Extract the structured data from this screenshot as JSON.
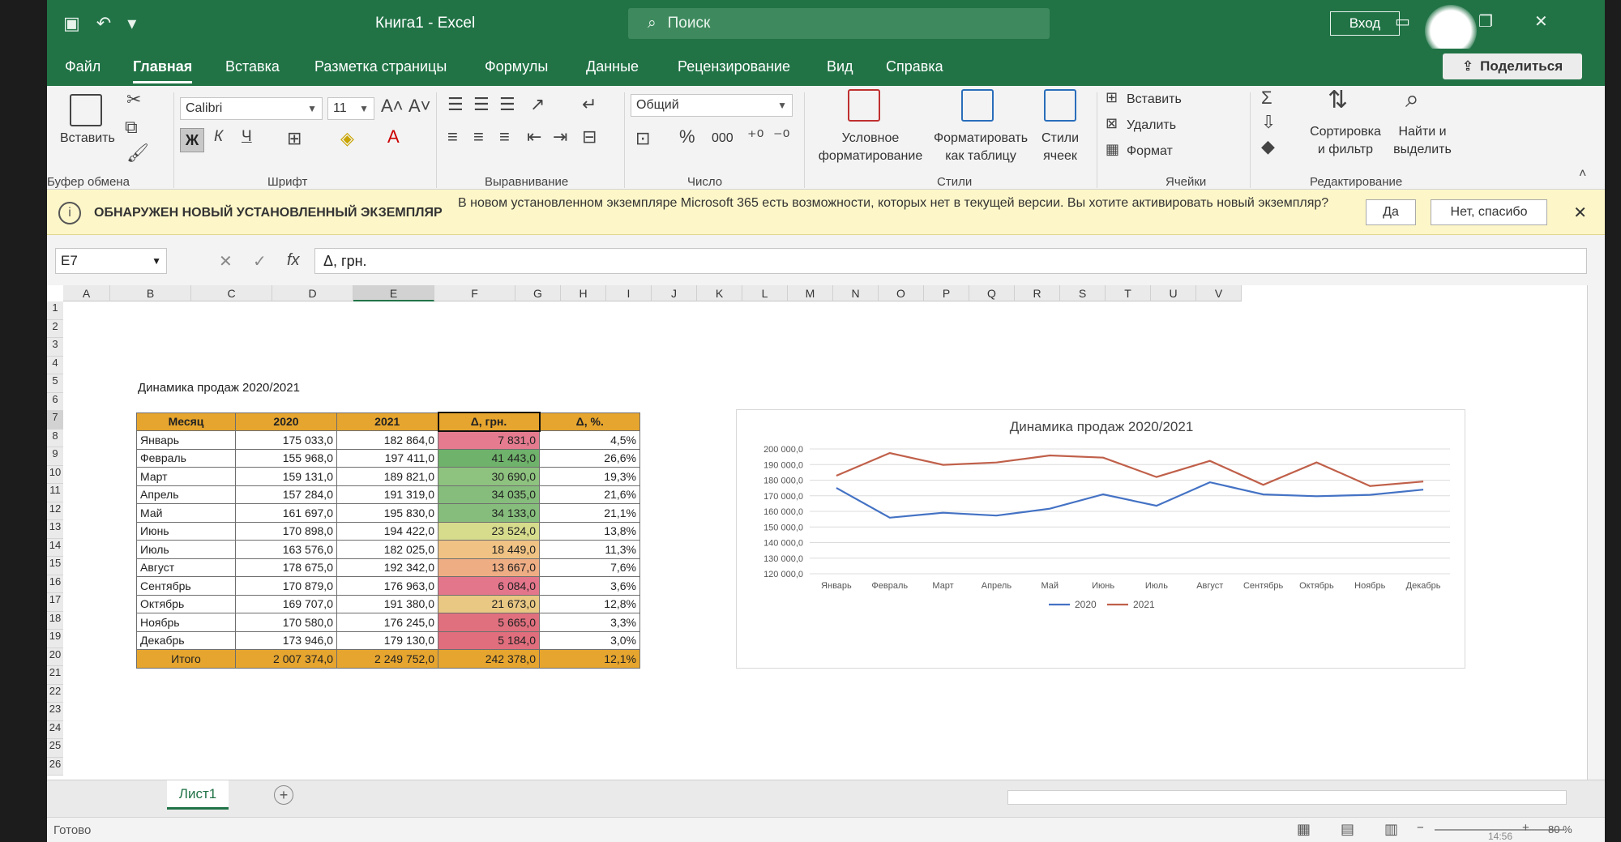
{
  "titlebar": {
    "doc_title": "Книга1 - Excel",
    "search_placeholder": "Поиск",
    "login_label": "Вход"
  },
  "tabs": [
    "Файл",
    "Главная",
    "Вставка",
    "Разметка страницы",
    "Формулы",
    "Данные",
    "Рецензирование",
    "Вид",
    "Справка"
  ],
  "share_label": "Поделиться",
  "ribbon": {
    "clipboard": {
      "paste": "Вставить",
      "label": "Буфер обмена"
    },
    "font": {
      "name": "Calibri",
      "size": "11",
      "bold": "Ж",
      "italic": "К",
      "underline": "Ч",
      "label": "Шрифт"
    },
    "alignment": {
      "label": "Выравнивание"
    },
    "number": {
      "format": "Общий",
      "percent": "%",
      "thousands": "000",
      "label": "Число"
    },
    "styles": {
      "cond_format": "Условное форматирование",
      "format_table": "Форматировать как таблицу",
      "cell_styles": "Стили ячеек",
      "label": "Стили"
    },
    "cells": {
      "insert": "Вставить",
      "delete": "Удалить",
      "format": "Формат",
      "label": "Ячейки"
    },
    "editing": {
      "sort": "Сортировка и фильтр",
      "find": "Найти и выделить",
      "label": "Редактирование"
    }
  },
  "notification": {
    "title": "ОБНАРУЖЕН НОВЫЙ УСТАНОВЛЕННЫЙ ЭКЗЕМПЛЯР",
    "message": "В новом установленном экземпляре Microsoft 365 есть возможности, которых нет в текущей версии. Вы хотите активировать новый экземпляр?",
    "yes": "Да",
    "no": "Нет, спасибо"
  },
  "formula_bar": {
    "name_box": "E7",
    "fx": "fx",
    "content": "Δ, грн."
  },
  "columns": [
    "A",
    "B",
    "C",
    "D",
    "E",
    "F",
    "G",
    "H",
    "I",
    "J",
    "K",
    "L",
    "M",
    "N",
    "O",
    "P",
    "Q",
    "R",
    "S",
    "T",
    "U",
    "V"
  ],
  "rows": [
    "1",
    "2",
    "3",
    "4",
    "5",
    "6",
    "7",
    "8",
    "9",
    "10",
    "11",
    "12",
    "13",
    "14",
    "15",
    "16",
    "17",
    "18",
    "19",
    "20",
    "21",
    "22",
    "23",
    "24",
    "25",
    "26"
  ],
  "table": {
    "title": "Динамика продаж 2020/2021",
    "headers": [
      "Месяц",
      "2020",
      "2021",
      "Δ, грн.",
      "Δ, %."
    ],
    "rows": [
      [
        "Январь",
        "175 033,0",
        "182 864,0",
        "7 831,0",
        "4,5%"
      ],
      [
        "Февраль",
        "155 968,0",
        "197 411,0",
        "41 443,0",
        "26,6%"
      ],
      [
        "Март",
        "159 131,0",
        "189 821,0",
        "30 690,0",
        "19,3%"
      ],
      [
        "Апрель",
        "157 284,0",
        "191 319,0",
        "34 035,0",
        "21,6%"
      ],
      [
        "Май",
        "161 697,0",
        "195 830,0",
        "34 133,0",
        "21,1%"
      ],
      [
        "Июнь",
        "170 898,0",
        "194 422,0",
        "23 524,0",
        "13,8%"
      ],
      [
        "Июль",
        "163 576,0",
        "182 025,0",
        "18 449,0",
        "11,3%"
      ],
      [
        "Август",
        "178 675,0",
        "192 342,0",
        "13 667,0",
        "7,6%"
      ],
      [
        "Сентябрь",
        "170 879,0",
        "176 963,0",
        "6 084,0",
        "3,6%"
      ],
      [
        "Октябрь",
        "169 707,0",
        "191 380,0",
        "21 673,0",
        "12,8%"
      ],
      [
        "Ноябрь",
        "170 580,0",
        "176 245,0",
        "5 665,0",
        "3,3%"
      ],
      [
        "Декабрь",
        "173 946,0",
        "179 130,0",
        "5 184,0",
        "3,0%"
      ]
    ],
    "delta_colors": [
      "#e47b8f",
      "#6fb26b",
      "#8ec27f",
      "#86bd7c",
      "#86bd7c",
      "#d7dc8d",
      "#f0c384",
      "#efad84",
      "#e4768c",
      "#e9c884",
      "#e0707e",
      "#e06e7d"
    ],
    "total": [
      "Итого",
      "2 007 374,0",
      "2 249 752,0",
      "242 378,0",
      "12,1%"
    ]
  },
  "chart_data": {
    "type": "line",
    "title": "Динамика продаж 2020/2021",
    "categories": [
      "Январь",
      "Февраль",
      "Март",
      "Апрель",
      "Май",
      "Июнь",
      "Июль",
      "Август",
      "Сентябрь",
      "Октябрь",
      "Ноябрь",
      "Декабрь"
    ],
    "series": [
      {
        "name": "2020",
        "color": "#4472c4",
        "values": [
          175033,
          155968,
          159131,
          157284,
          161697,
          170898,
          163576,
          178675,
          170879,
          169707,
          170580,
          173946
        ]
      },
      {
        "name": "2021",
        "color": "#c0604a",
        "values": [
          182864,
          197411,
          189821,
          191319,
          195830,
          194422,
          182025,
          192342,
          176963,
          191380,
          176245,
          179130
        ]
      }
    ],
    "ylim": [
      120000,
      200000
    ],
    "yticks": [
      "120 000,0",
      "130 000,0",
      "140 000,0",
      "150 000,0",
      "160 000,0",
      "170 000,0",
      "180 000,0",
      "190 000,0",
      "200 000,0"
    ],
    "legend": "bottom",
    "grid": true
  },
  "sheet_tab": "Лист1",
  "status": {
    "ready": "Готово",
    "zoom": "80 %",
    "time": "14:56"
  }
}
